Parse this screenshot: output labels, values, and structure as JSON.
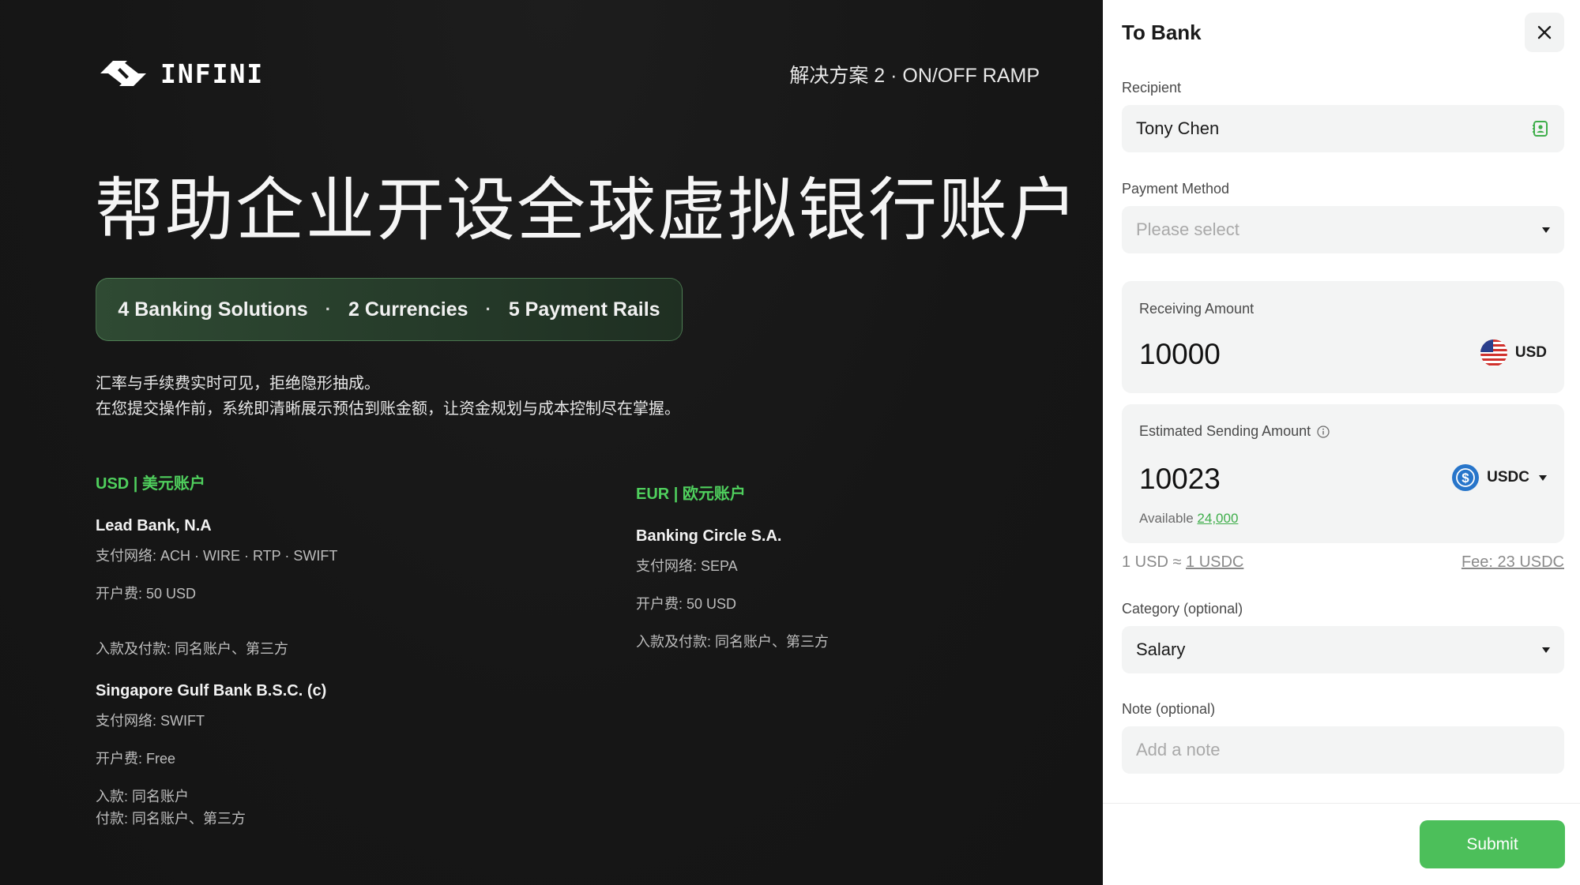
{
  "brand": {
    "name": "INFINI"
  },
  "section_tag": "解决方案 2 · ON/OFF RAMP",
  "hero_title": "帮助企业开设全球虚拟银行账户",
  "stats": [
    "4 Banking Solutions",
    "2 Currencies",
    "5 Payment Rails"
  ],
  "stats_separator": "·",
  "description": [
    "汇率与手续费实时可见，拒绝隐形抽成。",
    "在您提交操作前，系统即清晰展示预估到账金额，让资金规划与成本控制尽在掌握。"
  ],
  "usd_section": {
    "heading": "USD | 美元账户",
    "banks": [
      {
        "name": "Lead Bank, N.A",
        "network": "支付网络: ACH · WIRE · RTP · SWIFT",
        "fee": "开户费: 50 USD",
        "transfers": [
          "入款及付款: 同名账户、第三方"
        ]
      },
      {
        "name": "Singapore Gulf Bank B.S.C. (c)",
        "network": "支付网络: SWIFT",
        "fee": "开户费: Free",
        "transfers": [
          "入款: 同名账户",
          "付款: 同名账户、第三方"
        ]
      }
    ]
  },
  "eur_section": {
    "heading": "EUR | 欧元账户",
    "banks": [
      {
        "name": "Banking Circle S.A.",
        "network": "支付网络: SEPA",
        "fee": "开户费: 50 USD",
        "transfers": [
          "入款及付款: 同名账户、第三方"
        ]
      }
    ]
  },
  "form": {
    "title": "To Bank",
    "recipient_label": "Recipient",
    "recipient_value": "Tony Chen",
    "payment_method_label": "Payment Method",
    "payment_method_placeholder": "Please select",
    "receiving_label": "Receiving Amount",
    "receiving_amount": "10000",
    "receiving_currency": "USD",
    "sending_label": "Estimated Sending Amount",
    "sending_amount": "10023",
    "sending_currency": "USDC",
    "available_label": "Available",
    "available_value": "24,000",
    "rate_prefix": "1 USD ≈",
    "rate_value": "1 USDC",
    "fee": "Fee: 23 USDC",
    "category_label": "Category (optional)",
    "category_value": "Salary",
    "note_label": "Note (optional)",
    "note_placeholder": "Add a note",
    "submit_label": "Submit"
  },
  "colors": {
    "accent": "#4cbf5a",
    "dark_bg": "#161616",
    "usdc_blue": "#2775ca"
  },
  "icons": [
    "close-icon",
    "contact-book-icon",
    "chevron-down-icon",
    "info-icon",
    "us-flag-icon",
    "usdc-icon"
  ]
}
